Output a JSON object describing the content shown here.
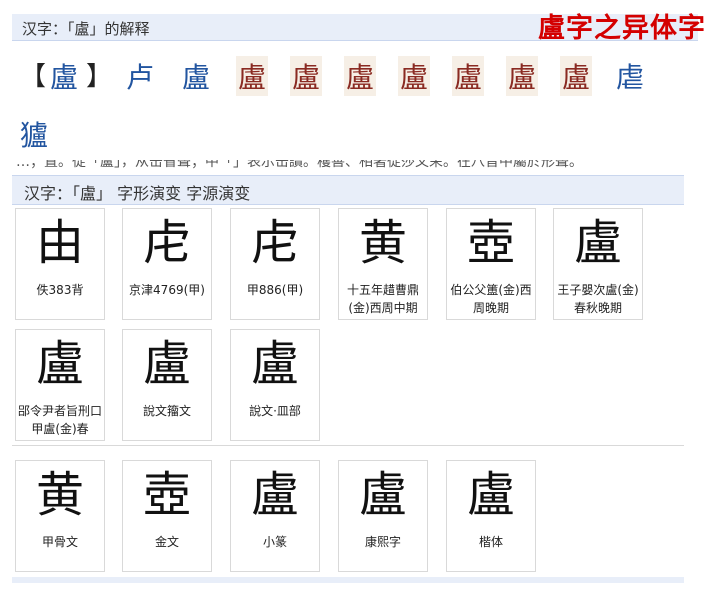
{
  "top": {
    "title": "汉字：「盧」的解释",
    "red_title": "盧字之异体字",
    "bracket_open": "【",
    "main_char": "盧",
    "bracket_close": "】",
    "variants": [
      "卢",
      "盧",
      "盧",
      "盧",
      "盧",
      "盧",
      "盧",
      "盧",
      "盧",
      "虐",
      "獹"
    ]
  },
  "clip_text": "…；置。從「盧」，从缶省聲；中「」表示缶讀。穫善、相著從莎文茉。在八音中屬於形聲。",
  "evolution": {
    "header_prefix": "汉字：「盧」",
    "link1": "字形演变",
    "link2": "字源演变"
  },
  "cards_row1": [
    {
      "glyph": "由",
      "label": "佚383背"
    },
    {
      "glyph": "虍",
      "label": "京津4769(甲)"
    },
    {
      "glyph": "虍",
      "label": "甲886(甲)"
    },
    {
      "glyph": "黄",
      "label": "十五年趞曹鼎(金)西周中期"
    },
    {
      "glyph": "壺",
      "label": "伯公父簠(金)西周晚期"
    },
    {
      "glyph": "盧",
      "label": "王子嬰次盧(金)春秋晚期"
    }
  ],
  "cards_row2": [
    {
      "glyph": "盧",
      "label": "郘令尹者旨刑口甲盧(金)春"
    },
    {
      "glyph": "盧",
      "label": "說文籀文"
    },
    {
      "glyph": "盧",
      "label": "說文·皿部"
    }
  ],
  "cards_row3": [
    {
      "glyph": "黄",
      "label": "甲骨文"
    },
    {
      "glyph": "壺",
      "label": "金文"
    },
    {
      "glyph": "盧",
      "label": "小篆"
    },
    {
      "glyph": "盧",
      "label": "康熙字"
    },
    {
      "glyph": "盧",
      "label": "楷体"
    }
  ]
}
